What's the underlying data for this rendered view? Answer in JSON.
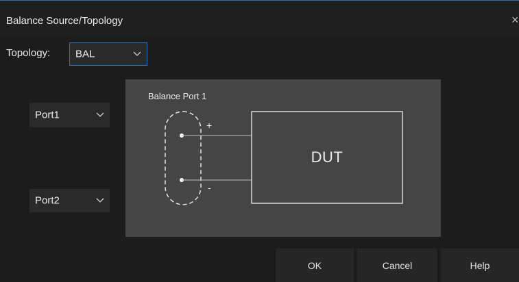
{
  "dialog": {
    "title": "Balance Source/Topology",
    "close_glyph": "×"
  },
  "topology": {
    "label": "Topology:",
    "value": "BAL"
  },
  "ports": [
    {
      "value": "Port1"
    },
    {
      "value": "Port2"
    }
  ],
  "diagram": {
    "title": "Balance Port 1",
    "dut_label": "DUT",
    "plus": "+",
    "minus": "-"
  },
  "buttons": {
    "ok": "OK",
    "cancel": "Cancel",
    "help": "Help"
  },
  "colors": {
    "accent": "#2e74c0",
    "diagram_bg": "#454545",
    "dialog_bg": "#1c1c1c",
    "control_bg": "#2a2a2a"
  },
  "icons": {
    "close": "close-icon",
    "dropdown": "chevron-down-icon"
  }
}
